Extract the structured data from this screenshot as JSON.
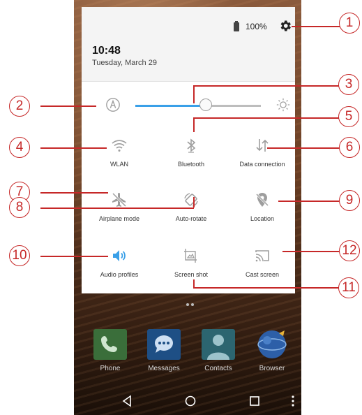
{
  "status_bar": {
    "battery_text": "100%"
  },
  "header": {
    "time": "10:48",
    "date": "Tuesday, March 29"
  },
  "brightness": {
    "level": 0.56
  },
  "tiles": [
    {
      "label": "WLAN",
      "icon": "wifi-icon",
      "active": false
    },
    {
      "label": "Bluetooth",
      "icon": "bluetooth-icon",
      "active": false
    },
    {
      "label": "Data connection",
      "icon": "data-connection-icon",
      "active": false
    },
    {
      "label": "Airplane mode",
      "icon": "airplane-icon",
      "active": false
    },
    {
      "label": "Auto-rotate",
      "icon": "auto-rotate-icon",
      "active": false
    },
    {
      "label": "Location",
      "icon": "location-off-icon",
      "active": false
    },
    {
      "label": "Audio profiles",
      "icon": "volume-icon",
      "active": true
    },
    {
      "label": "Screen shot",
      "icon": "screenshot-icon",
      "active": false
    },
    {
      "label": "Cast screen",
      "icon": "cast-icon",
      "active": false
    }
  ],
  "dock": [
    {
      "label": "Phone",
      "icon": "phone-icon"
    },
    {
      "label": "Messages",
      "icon": "messages-icon"
    },
    {
      "label": "Contacts",
      "icon": "contacts-icon"
    },
    {
      "label": "Browser",
      "icon": "browser-icon"
    }
  ],
  "callouts": [
    "1",
    "2",
    "3",
    "4",
    "5",
    "6",
    "7",
    "8",
    "9",
    "10",
    "11",
    "12"
  ],
  "colors": {
    "accent": "#3aa0e8",
    "callout": "#c62828",
    "inactive_icon": "#9e9e9e"
  }
}
